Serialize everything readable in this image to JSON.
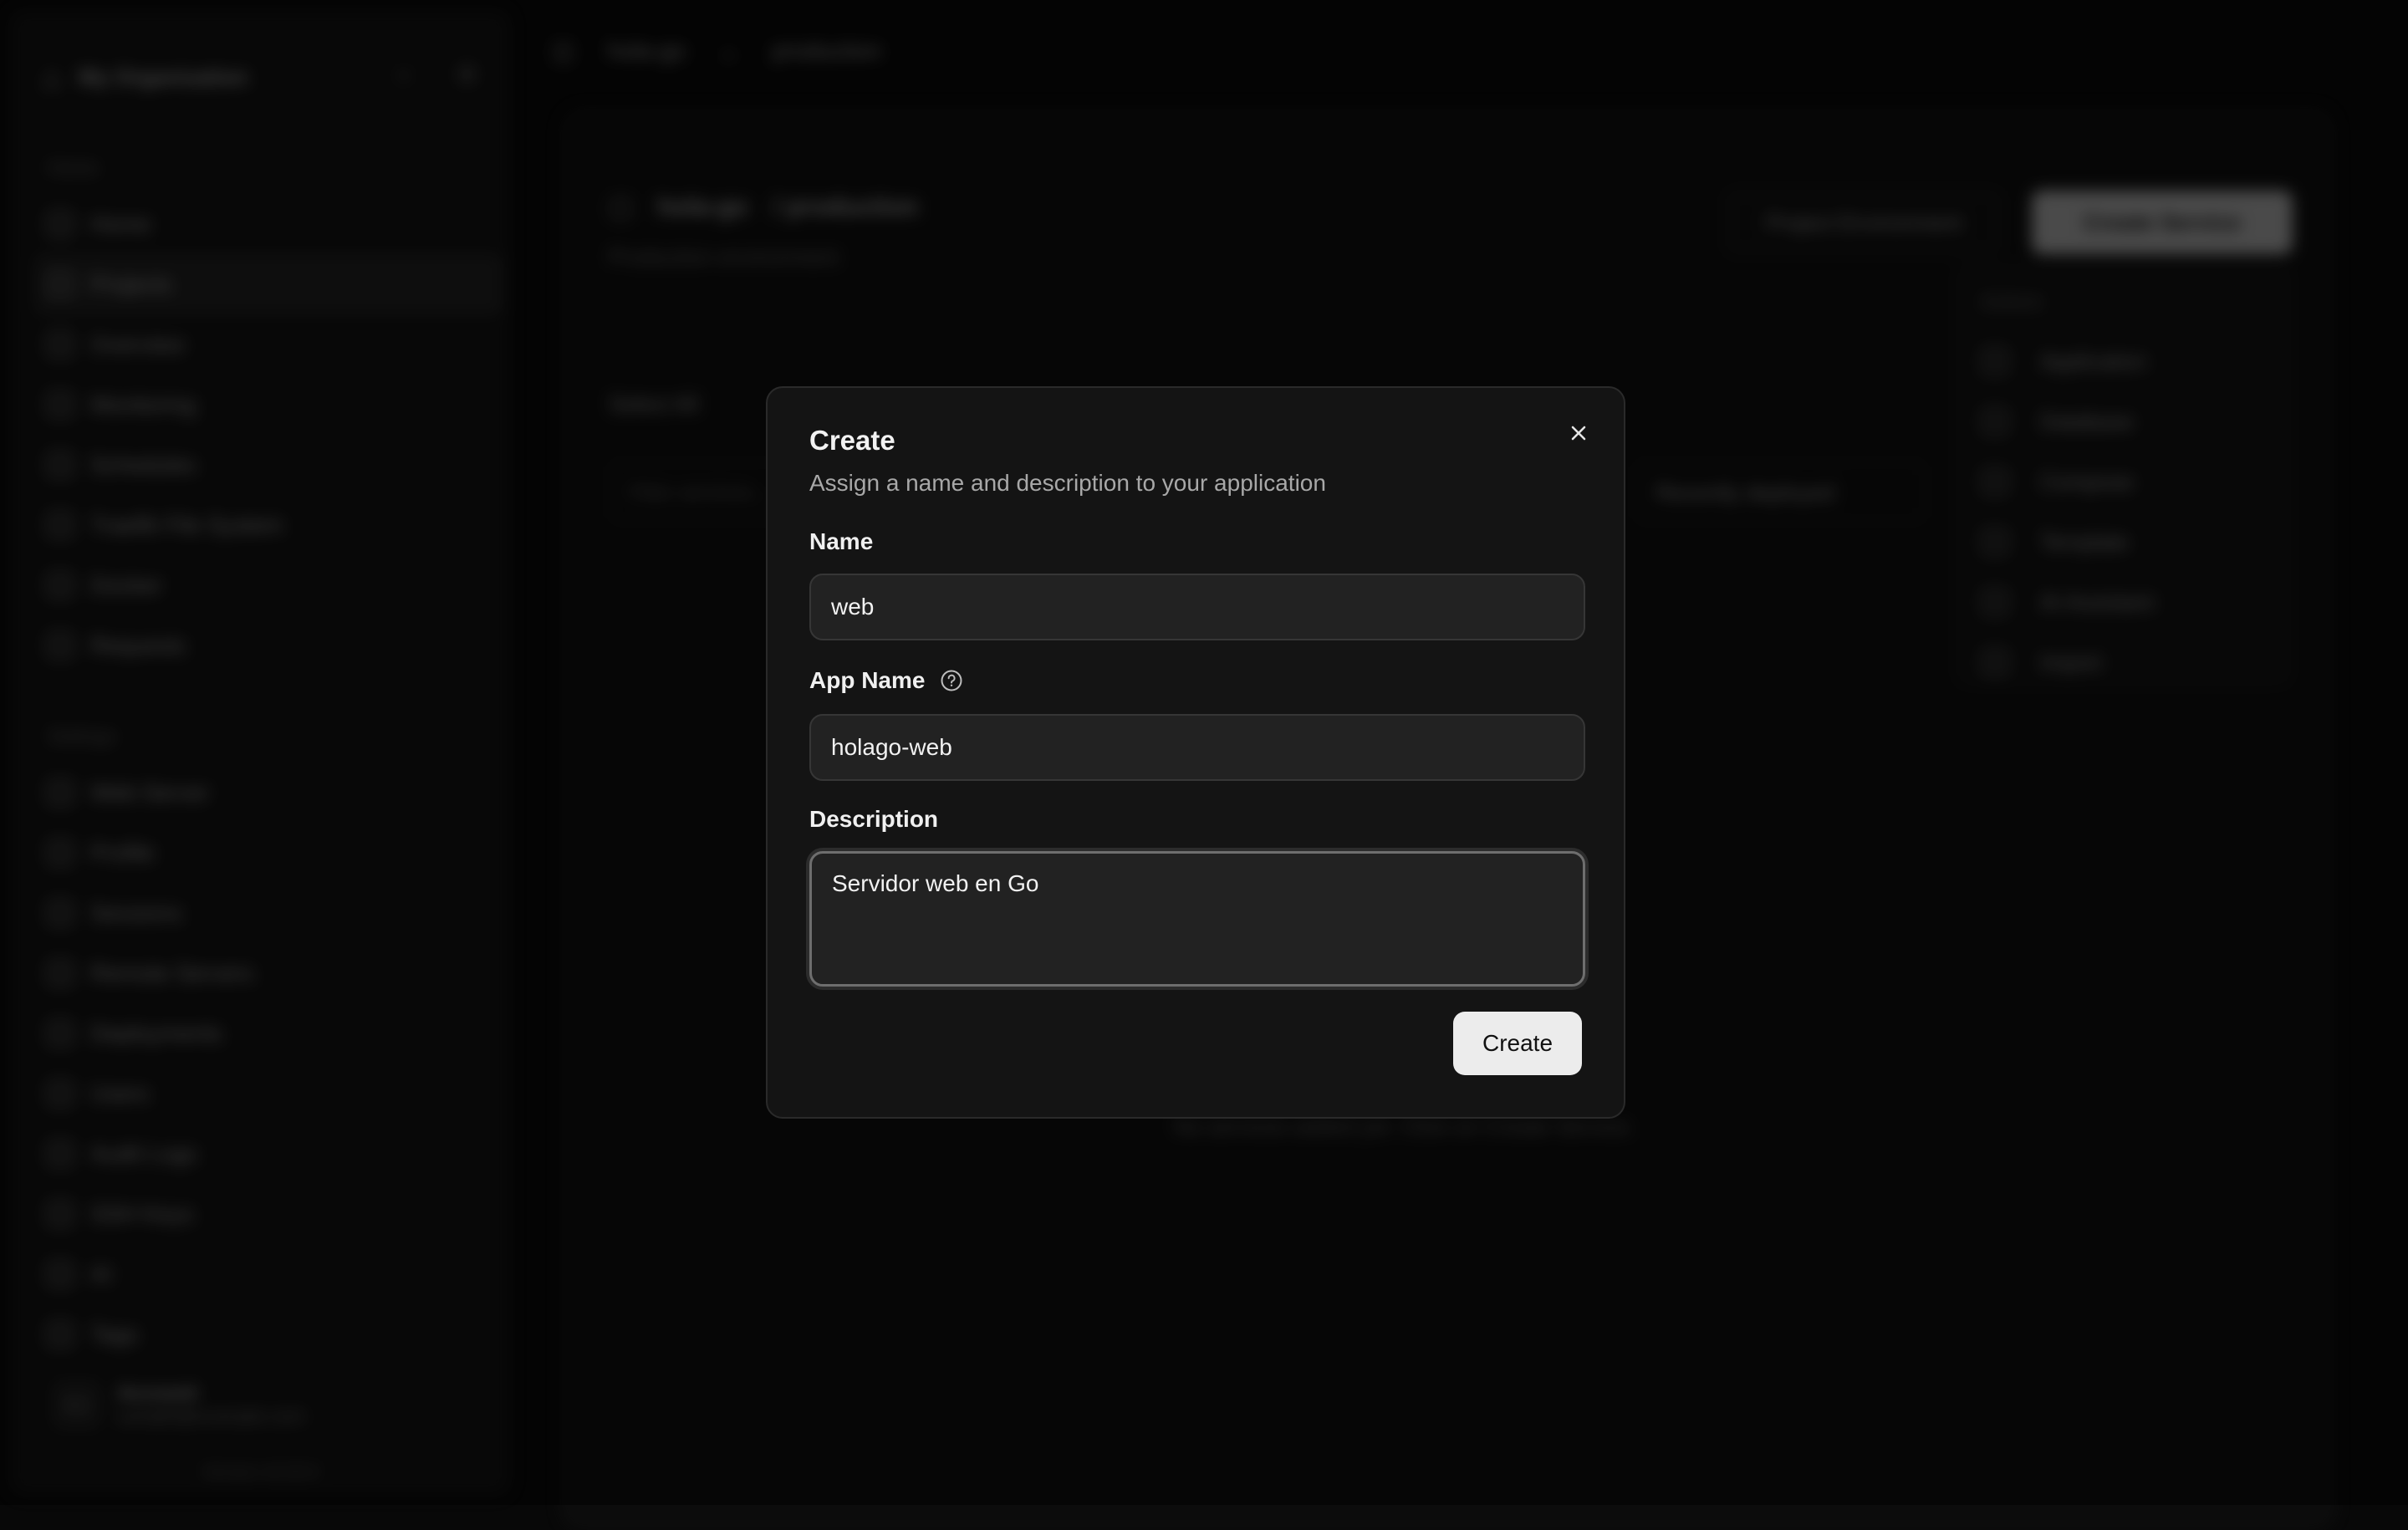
{
  "sidebar": {
    "org_name": "My Organization",
    "home_group_label": "Home",
    "home_items": [
      {
        "label": "Home"
      },
      {
        "label": "Projects"
      },
      {
        "label": "Overview"
      },
      {
        "label": "Monitoring"
      },
      {
        "label": "Schedules"
      },
      {
        "label": "Traefik File System"
      },
      {
        "label": "Docker"
      },
      {
        "label": "Requests"
      }
    ],
    "settings_group_label": "Settings",
    "settings_items": [
      {
        "label": "Web Server"
      },
      {
        "label": "Profile"
      },
      {
        "label": "Sessions"
      },
      {
        "label": "Remote Servers"
      },
      {
        "label": "Deployments"
      },
      {
        "label": "Users"
      },
      {
        "label": "Audit Logs"
      },
      {
        "label": "SSH Keys"
      },
      {
        "label": "AI"
      },
      {
        "label": "Tags"
      }
    ],
    "user": {
      "avatar_text": "Acc",
      "name": "Account",
      "email": "sample@example.com"
    },
    "version": "Version v0.25.0"
  },
  "topbar": {
    "project": "hola-go",
    "environment": "production"
  },
  "project": {
    "title": "hola-go",
    "env_badge": "/ production",
    "description": "Production environment",
    "env_button": "Project Environment",
    "create_service_button": "Create Service",
    "select_all": "Select All",
    "filter_placeholder": "Filter services...",
    "sort_value": "Recently deployed",
    "empty_message": "No services added yet. Click on Create Service."
  },
  "actions_menu": {
    "label": "Actions",
    "items": [
      {
        "label": "Application"
      },
      {
        "label": "Database"
      },
      {
        "label": "Compose"
      },
      {
        "label": "Template"
      },
      {
        "label": "AI Assistant"
      },
      {
        "label": "Import"
      }
    ]
  },
  "dialog": {
    "title": "Create",
    "subtitle": "Assign a name and description to your application",
    "name_label": "Name",
    "name_value": "web",
    "app_name_label": "App Name",
    "app_name_value": "holago-web",
    "description_label": "Description",
    "description_value": "Servidor web en Go",
    "submit_label": "Create"
  }
}
